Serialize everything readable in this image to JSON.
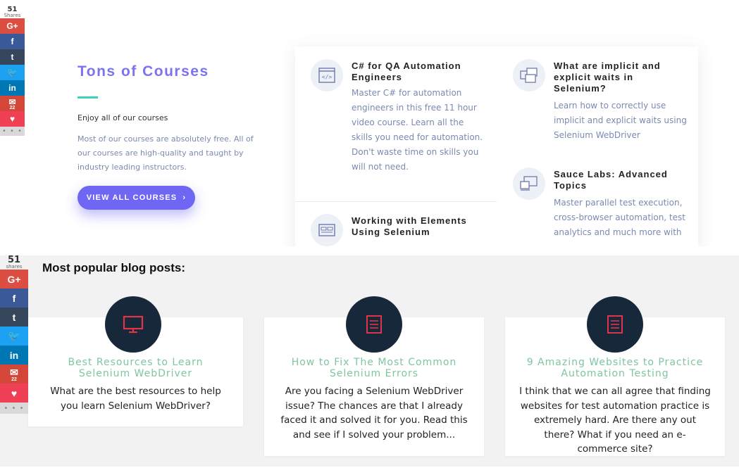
{
  "share_top": {
    "count": "51",
    "label": "Shares",
    "buttons": [
      {
        "name": "google-plus-share",
        "label": "G+",
        "color": "#dc4e41",
        "icon": "google-plus-icon"
      },
      {
        "name": "facebook-share",
        "label": "f",
        "color": "#3b5998",
        "icon": "facebook-icon"
      },
      {
        "name": "tumblr-share",
        "label": "t",
        "color": "#36465d",
        "icon": "tumblr-icon"
      },
      {
        "name": "twitter-share",
        "label": "🐦",
        "color": "#1da1f2",
        "icon": "twitter-icon"
      },
      {
        "name": "linkedin-share",
        "label": "in",
        "color": "#0077b5",
        "icon": "linkedin-icon"
      },
      {
        "name": "email-share",
        "label": "✉",
        "sub": "22",
        "color": "#d44638",
        "icon": "email-icon"
      },
      {
        "name": "pocket-share",
        "label": "♥",
        "color": "#ef4056",
        "icon": "pocket-icon"
      }
    ],
    "more": "• • •"
  },
  "share_bottom": {
    "count": "51",
    "label": "shares",
    "buttons": [
      {
        "name": "google-plus-share",
        "label": "G+",
        "color": "#dc4e41",
        "icon": "google-plus-icon"
      },
      {
        "name": "facebook-share",
        "label": "f",
        "color": "#3b5998",
        "icon": "facebook-icon"
      },
      {
        "name": "tumblr-share",
        "label": "t",
        "color": "#36465d",
        "icon": "tumblr-icon"
      },
      {
        "name": "twitter-share",
        "label": "🐦",
        "color": "#1da1f2",
        "icon": "twitter-icon"
      },
      {
        "name": "linkedin-share",
        "label": "in",
        "color": "#0077b5",
        "icon": "linkedin-icon"
      },
      {
        "name": "email-share",
        "label": "✉",
        "sub": "22",
        "color": "#d44638",
        "icon": "email-icon"
      },
      {
        "name": "pocket-share",
        "label": "♥",
        "color": "#ef4056",
        "icon": "pocket-icon"
      }
    ],
    "more": "• • •"
  },
  "courses": {
    "title": "Tons of Courses",
    "subtitle": "Enjoy all of our courses",
    "description": "Most of our courses are absolutely free. All of our courses are high-quality and taught by industry leading instructors.",
    "button_label": "VIEW ALL COURSES",
    "button_arrow": "›",
    "accent_color": "#6f66f3",
    "items": [
      {
        "title": "C# for QA Automation Engineers",
        "description": "Master C# for automation engineers in this free 11 hour video course. Learn all the skills you need for automation. Don't waste time on skills you will not need.",
        "icon": "code-window-icon"
      },
      {
        "title": "Working with Elements Using Selenium",
        "description": "",
        "icon": "browser-elements-icon"
      },
      {
        "title": "What are implicit and explicit waits in Selenium?",
        "description": "Learn how to correctly use implicit and explicit waits using Selenium WebDriver",
        "icon": "windows-icon"
      },
      {
        "title": "Sauce Labs: Advanced Topics",
        "description": "Master parallel test execution, cross-browser automation, test analytics and much more with ...",
        "icon": "devices-icon"
      }
    ]
  },
  "blog": {
    "heading": "Most popular blog posts:",
    "title_color": "#7ec6a0",
    "icon_color": "#e0344a",
    "posts": [
      {
        "title": "Best Resources to Learn Selenium WebDriver",
        "excerpt": "What are the best resources to help you learn Selenium WebDriver?",
        "icon": "monitor-icon"
      },
      {
        "title": "How to Fix The Most Common Selenium Errors",
        "excerpt": "Are you facing a Selenium WebDriver issue? The chances are that I already faced it and solved it for you. Read this and see if I solved your problem...",
        "icon": "document-icon"
      },
      {
        "title": "9 Amazing Websites to Practice Automation Testing",
        "excerpt": "I think that we can all agree that finding websites for test automation practice is extremely hard. Are there any out there? What if you need an e-commerce site?",
        "icon": "document-icon"
      }
    ]
  }
}
